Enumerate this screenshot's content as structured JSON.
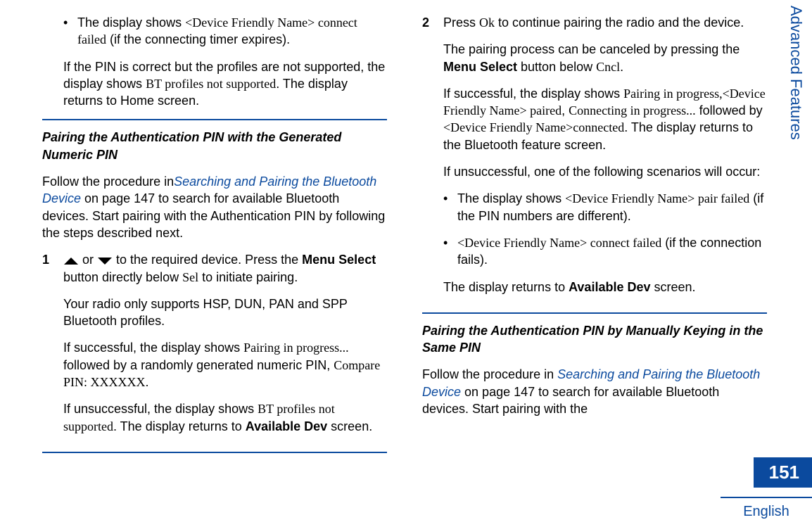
{
  "side_tab": "Advanced Features",
  "page_number": "151",
  "language": "English",
  "col1": {
    "bullet1_pre": "The display shows ",
    "bullet1_screen": "<Device Friendly Name> connect failed",
    "bullet1_post": " (if the connecting timer expires).",
    "p1_a": "If the PIN is correct but the profiles are not supported, the display shows ",
    "p1_screen": "BT profiles not supported",
    "p1_b": ". The display returns to Home screen.",
    "subhead1": "Pairing the Authentication PIN with the Generated Numeric PIN",
    "p2_a": "Follow the procedure in",
    "p2_link": "Searching and Pairing the Bluetooth Device",
    "p2_b": " on page 147 to search for available Bluetooth devices. Start pairing with the Authentication PIN by following the steps described next.",
    "step1_num": "1",
    "step1_line1_a": " or ",
    "step1_line1_b": " to the required device. Press the ",
    "step1_line1_bold": "Menu Select",
    "step1_line1_c": " button directly below ",
    "step1_line1_screen": "Sel",
    "step1_line1_d": " to initiate pairing.",
    "step1_p2": "Your radio only supports HSP, DUN, PAN and SPP Bluetooth profiles.",
    "step1_p3_a": "If successful, the display shows ",
    "step1_p3_screen1": "Pairing in progress...",
    "step1_p3_b": " followed by a randomly generated numeric PIN, ",
    "step1_p3_screen2": "Compare PIN: XXXXXX",
    "step1_p3_c": ".",
    "step1_p4_a": "If unsuccessful, the display shows ",
    "step1_p4_screen": "BT profiles not supported",
    "step1_p4_b": ". The display returns to ",
    "step1_p4_bold": "Available Dev",
    "step1_p4_c": " screen."
  },
  "col2": {
    "step2_num": "2",
    "step2_line1_a": "Press ",
    "step2_line1_screen": "Ok",
    "step2_line1_b": " to continue pairing the radio and the device.",
    "step2_p2_a": "The pairing process can be canceled by pressing the ",
    "step2_p2_bold": "Menu Select",
    "step2_p2_b": " button below ",
    "step2_p2_screen": "Cncl",
    "step2_p2_c": ".",
    "step2_p3_a": "If successful, the display shows ",
    "step2_p3_screen1": "Pairing in progress,",
    "step2_p3_screen2": "<Device Friendly Name> paired",
    "step2_p3_mid1": ", ",
    "step2_p3_screen3": "Connecting in progress...",
    "step2_p3_mid2": " followed by ",
    "step2_p3_screen4": "<Device Friendly Name>connected",
    "step2_p3_b": ". The display returns to the Bluetooth feature screen.",
    "step2_p4": "If unsuccessful, one of the following scenarios will occur:",
    "bullet1_a": "The display shows ",
    "bullet1_screen": "<Device Friendly Name> pair failed",
    "bullet1_b": " (if the PIN numbers are different).",
    "bullet2_screen": "<Device Friendly Name> connect failed",
    "bullet2_b": " (if the connection fails).",
    "p_last_a": "The display returns to ",
    "p_last_bold": "Available Dev",
    "p_last_b": " screen.",
    "subhead2": "Pairing the Authentication PIN by Manually Keying in the Same PIN",
    "p_follow_a": "Follow the procedure in ",
    "p_follow_link": "Searching and Pairing the Bluetooth Device",
    "p_follow_b": " on page 147 to search for available Bluetooth devices. Start pairing with the"
  }
}
